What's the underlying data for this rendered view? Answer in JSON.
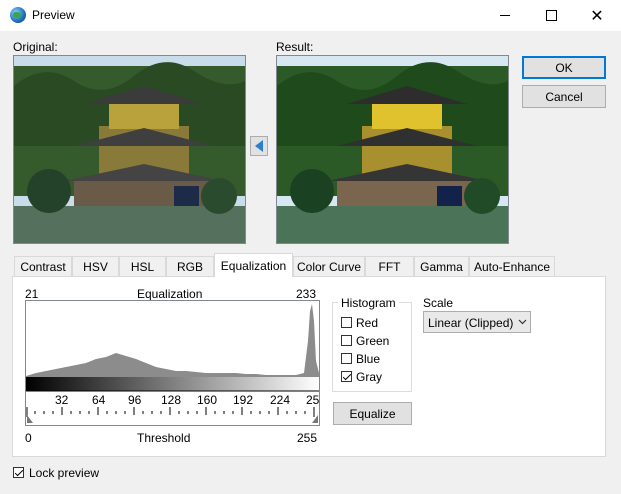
{
  "window": {
    "title": "Preview"
  },
  "labels": {
    "original": "Original:",
    "result": "Result:"
  },
  "buttons": {
    "ok": "OK",
    "cancel": "Cancel",
    "equalize": "Equalize"
  },
  "tabs": [
    "Contrast",
    "HSV",
    "HSL",
    "RGB",
    "Equalization",
    "Color Curve",
    "FFT",
    "Gamma",
    "Auto-Enhance"
  ],
  "active_tab": "Equalization",
  "equalization": {
    "title": "Equalization",
    "low_value": "21",
    "high_value": "233",
    "scale_ticks": [
      "32",
      "64",
      "96",
      "128",
      "160",
      "192",
      "224",
      "25"
    ],
    "min_label": "0",
    "max_label": "255",
    "threshold_label": "Threshold"
  },
  "histogram_group": {
    "title": "Histogram",
    "items": [
      {
        "label": "Red",
        "checked": false
      },
      {
        "label": "Green",
        "checked": false
      },
      {
        "label": "Blue",
        "checked": false
      },
      {
        "label": "Gray",
        "checked": true
      }
    ]
  },
  "scale": {
    "label": "Scale",
    "value": "Linear (Clipped)"
  },
  "lock_preview": {
    "label": "Lock preview",
    "checked": true
  },
  "icons": {
    "app": "globe-icon",
    "minimize": "minimize-icon",
    "maximize": "maximize-icon",
    "close": "close-icon",
    "copy_back": "left-arrow-icon",
    "dropdown": "chevron-down-icon"
  },
  "colors": {
    "accent": "#0078d7",
    "arrow_button": "#2a7fd0"
  }
}
